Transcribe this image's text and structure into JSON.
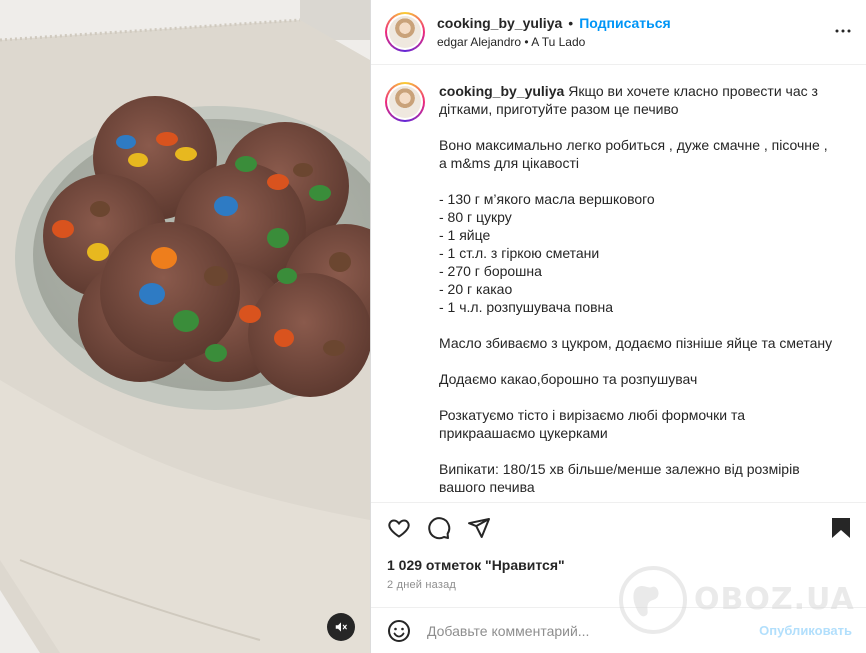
{
  "post": {
    "username": "cooking_by_yuliya",
    "separator": "•",
    "follow_label": "Подписаться",
    "music": "edgar Alejandro • A Tu Lado",
    "caption_lines": [
      "Якщо ви хочете класно провести час з дітками, приготуйте разом це печиво",
      "",
      "Воно максимально легко робиться , дуже смачне , пісочне , а m&ms для цікавості",
      "",
      "- 130 г м’якого масла вершкового",
      "- 80 г цукру",
      "- 1 яйце",
      "- 1 ст.л. з гіркою сметани",
      "- 270 г борошна",
      "- 20 г какао",
      "- 1 ч.л. розпушувача повна",
      "",
      "Масло збиваємо з цукром, додаємо пізніше яйце та сметану",
      "",
      "Додаємо какао,борошно та розпушувач",
      "",
      "Розкатуємо тісто і вирізаємо любі формочки та прикраашаємо цукерками",
      "",
      "Випікати: 180/15 хв більше/менше залежно від розмірів вашого печива"
    ],
    "likes": "1 029 отметок \"Нравится\"",
    "date": "2 дней назад"
  },
  "comment": {
    "placeholder": "Добавьте комментарий...",
    "post_label": "Опубликовать"
  },
  "watermark": {
    "text": "OBOZ.UA"
  },
  "icons": {
    "like": "heart-icon",
    "comment": "comment-icon",
    "share": "paper-plane-icon",
    "save": "bookmark-icon",
    "emoji": "emoji-icon",
    "more": "more-dots-icon",
    "mute": "speaker-muted-icon"
  },
  "colors": {
    "accent": "#0095f6",
    "post_disabled": "#b2dffc",
    "muted_text": "#8e8e8e"
  }
}
